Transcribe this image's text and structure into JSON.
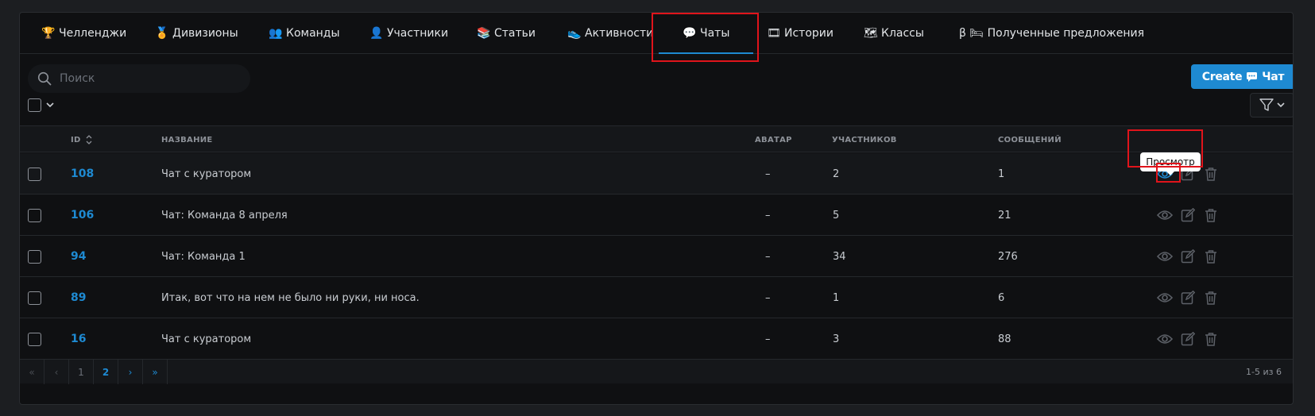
{
  "tabs": [
    {
      "label": "Челленджи",
      "icon": "trophy-icon",
      "glyph": "🏆"
    },
    {
      "label": "Дивизионы",
      "icon": "division-icon",
      "glyph": "🏅"
    },
    {
      "label": "Команды",
      "icon": "team-icon",
      "glyph": "👥"
    },
    {
      "label": "Участники",
      "icon": "participant-icon",
      "glyph": "👤"
    },
    {
      "label": "Статьи",
      "icon": "articles-icon",
      "glyph": "📚"
    },
    {
      "label": "Активности",
      "icon": "activity-icon",
      "glyph": "👟"
    },
    {
      "label": "Чаты",
      "icon": "chat-icon",
      "glyph": "💬",
      "active": true
    },
    {
      "label": "Истории",
      "icon": "stories-icon",
      "glyph": "🎞"
    },
    {
      "label": "Классы",
      "icon": "classes-icon",
      "glyph": "🗺"
    },
    {
      "label": "β 🛏 Полученные предложения",
      "icon": "offers-icon",
      "glyph": ""
    }
  ],
  "search": {
    "placeholder": "Поиск"
  },
  "create_button": {
    "label_prefix": "Create",
    "label_suffix": "Чат",
    "icon": "chat-icon"
  },
  "columns": {
    "id": "ID",
    "name": "НАЗВАНИЕ",
    "avatar": "АВАТАР",
    "participants": "УЧАСТНИКОВ",
    "messages": "СООБЩЕНИЙ"
  },
  "rows": [
    {
      "id": "108",
      "name": "Чат с куратором",
      "avatar": "–",
      "participants": "2",
      "messages": "1"
    },
    {
      "id": "106",
      "name": "Чат: Команда 8 апреля",
      "avatar": "–",
      "participants": "5",
      "messages": "21"
    },
    {
      "id": "94",
      "name": "Чат: Команда 1",
      "avatar": "–",
      "participants": "34",
      "messages": "276"
    },
    {
      "id": "89",
      "name": "Итак, вот что на нем не было ни руки, ни носа.",
      "avatar": "–",
      "participants": "1",
      "messages": "6"
    },
    {
      "id": "16",
      "name": "Чат с куратором",
      "avatar": "–",
      "participants": "3",
      "messages": "88"
    }
  ],
  "tooltip": {
    "text": "Просмотр"
  },
  "pagination": {
    "first": "«",
    "prev": "‹",
    "pages": [
      "1",
      "2"
    ],
    "current": "2",
    "next": "›",
    "last": "»",
    "range": "1-5 из 6"
  },
  "colors": {
    "accent": "#1e8ad2",
    "highlight": "#e0141b",
    "background": "#0f1012"
  }
}
